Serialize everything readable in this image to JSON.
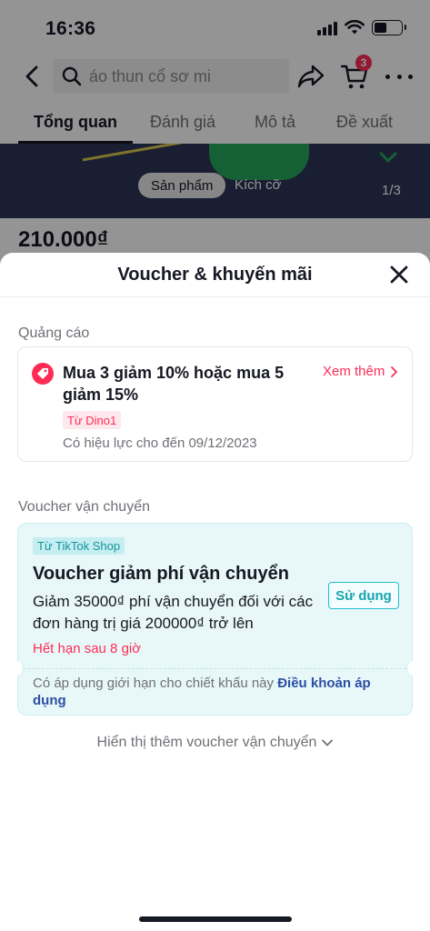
{
  "status_bar": {
    "time": "16:36"
  },
  "header": {
    "search_text": "áo thun cổ sơ mi",
    "cart_count": "3"
  },
  "tabs": [
    {
      "label": "Tổng quan",
      "active": true
    },
    {
      "label": "Đánh giá"
    },
    {
      "label": "Mô tả"
    },
    {
      "label": "Đề xuất"
    }
  ],
  "gallery": {
    "pill_product": "Sản phẩm",
    "pill_size": "Kích cỡ",
    "page_indicator": "1/3"
  },
  "product": {
    "price": "210.000₫"
  },
  "sheet": {
    "title": "Voucher & khuyến mãi",
    "ads_section": {
      "label": "Quảng cáo",
      "promo": {
        "title": "Mua 3 giảm 10% hoặc mua 5 giảm 15%",
        "see_more": "Xem thêm",
        "from": "Từ Dino1",
        "valid_until": "Có hiệu lực cho đến 09/12/2023"
      }
    },
    "shipping_section": {
      "label": "Voucher vận chuyển",
      "voucher": {
        "tag": "Từ TikTok Shop",
        "title": "Voucher giảm phí vận chuyển",
        "description": "Giảm 35000₫ phí vận chuyển đối với các đơn hàng trị giá 200000₫ trở lên",
        "use_button": "Sử dụng",
        "expire": "Hết hạn sau 8 giờ",
        "terms_text": "Có áp dụng giới hạn cho chiết khấu này ",
        "terms_link": "Điều khoản áp dụng"
      }
    },
    "show_more": "Hiển thị thêm voucher vận chuyển"
  },
  "colors": {
    "accent": "#fe2c55",
    "teal": "#14a5b0",
    "link": "#2b4ea2"
  }
}
